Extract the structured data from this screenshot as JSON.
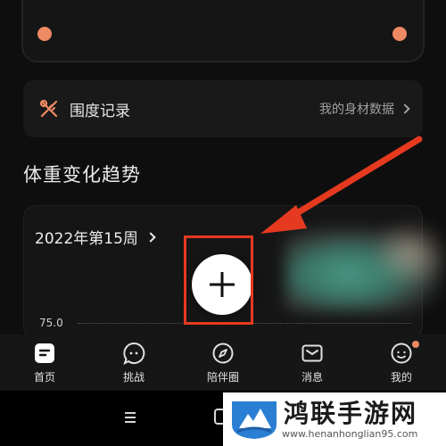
{
  "girth": {
    "title": "围度记录",
    "link_label": "我的身材数据",
    "icon": "tape-measure-icon"
  },
  "section": {
    "title": "体重变化趋势"
  },
  "chart": {
    "week_label": "2022年第15周",
    "y_tick": "75.0"
  },
  "fab": {
    "icon": "plus-icon"
  },
  "tabs": [
    {
      "label": "首页",
      "icon": "home-icon"
    },
    {
      "label": "挑战",
      "icon": "chat-icon"
    },
    {
      "label": "陪伴圈",
      "icon": "compass-icon"
    },
    {
      "label": "消息",
      "icon": "mail-icon"
    },
    {
      "label": "我的",
      "icon": "profile-icon"
    }
  ],
  "watermark": {
    "title": "鸿联手游网",
    "url": "www.henanhonglian95.com"
  },
  "colors": {
    "accent": "#ee8a63",
    "annotation": "#e53a20",
    "background": "#0e0e0e"
  }
}
